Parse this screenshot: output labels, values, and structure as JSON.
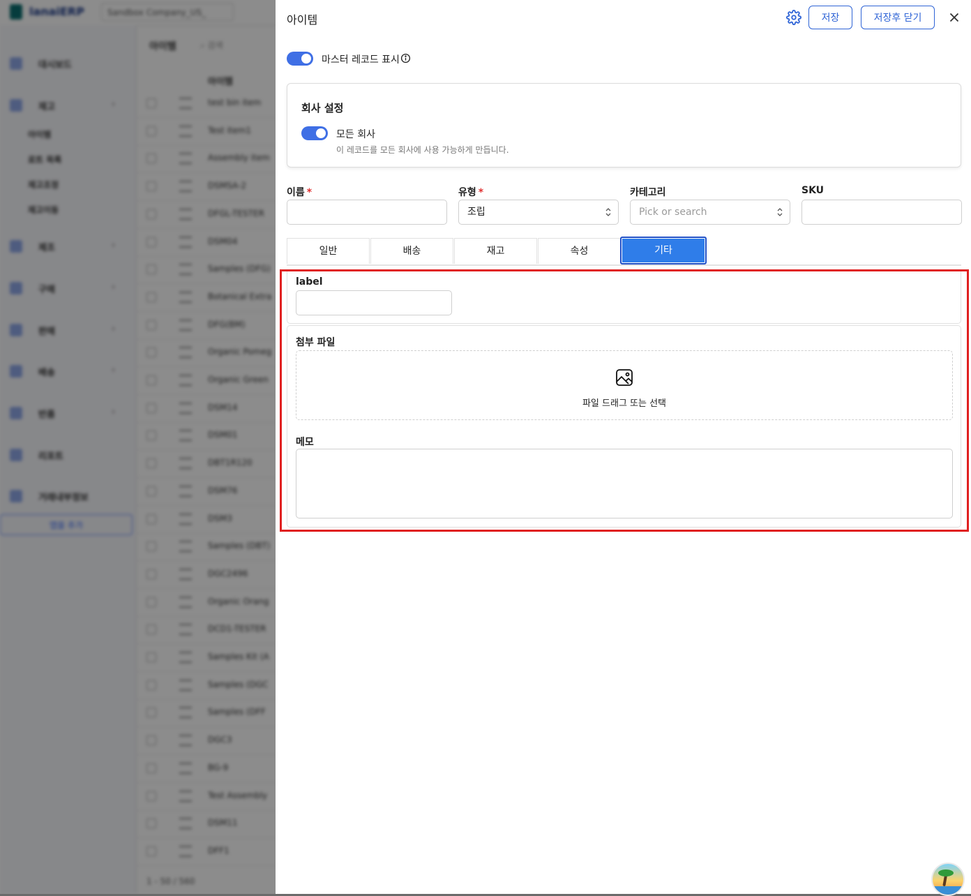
{
  "drawer": {
    "title": "아이템",
    "save_label": "저장",
    "save_close_label": "저장후 닫기",
    "master_toggle_label": "마스터 레코드 표시",
    "master_toggle_on": true
  },
  "company_settings": {
    "title": "회사 설정",
    "all_companies_label": "모든 회사",
    "all_companies_desc": "이 레코드를 모든 회사에 사용 가능하게 만듭니다.",
    "all_companies_on": true
  },
  "fields": {
    "name": {
      "label": "이름",
      "required": "*",
      "value": ""
    },
    "type": {
      "label": "유형",
      "required": "*",
      "value": "조립"
    },
    "category": {
      "label": "카테고리",
      "placeholder": "Pick or search"
    },
    "sku": {
      "label": "SKU",
      "value": ""
    }
  },
  "tabs": [
    {
      "label": "일반",
      "active": false
    },
    {
      "label": "배송",
      "active": false
    },
    {
      "label": "재고",
      "active": false
    },
    {
      "label": "속성",
      "active": false
    },
    {
      "label": "기타",
      "active": true
    }
  ],
  "other_tab": {
    "label_field": "label",
    "attachments_label": "첨부 파일",
    "dropzone_text": "파일 드래그 또는 선택",
    "memo_label": "메모"
  },
  "colors": {
    "accent": "#2f64d6",
    "toggle_on": "#3f6fe5",
    "tab_active": "#2f7de9",
    "highlight": "#e02020",
    "required": "#e03131"
  },
  "background_app": {
    "logo": "lanaiERP",
    "company": "Sandbox Company_US_",
    "nav": [
      {
        "label": "대시보드",
        "expandable": false
      },
      {
        "label": "재고",
        "expandable": true
      },
      {
        "label": "제조",
        "expandable": true
      },
      {
        "label": "구매",
        "expandable": true
      },
      {
        "label": "판매",
        "expandable": true
      },
      {
        "label": "배송",
        "expandable": true
      },
      {
        "label": "반품",
        "expandable": true
      },
      {
        "label": "리포트",
        "expandable": false
      },
      {
        "label": "거래내부정보",
        "expandable": false
      }
    ],
    "subnav": [
      "아이템",
      "로트 목록",
      "재고조정",
      "재고이동"
    ],
    "add_button": "앱을 추가",
    "list_title": "아이템",
    "search_placeholder": "검색",
    "column_header": "아이템",
    "rows": [
      "test bin item",
      "Test item1",
      "Assembly item",
      "DSMSA-2",
      "DFGL-TESTER",
      "DSM04",
      "Samples (DFG)",
      "Botanical Extra",
      "DFG(BM)",
      "Organic Pomeg",
      "Organic Green",
      "DSM14",
      "DSM01",
      "DBT1R120",
      "DSM76",
      "DSM3",
      "Samples (DBT)",
      "DGC2496",
      "Organic Orang",
      "DCD1-TESTER",
      "Samples Kit (A",
      "Samples (DGC",
      "Samples (DFF",
      "DGC3",
      "BG-9",
      "Test Assembly",
      "DSM11",
      "DFF1"
    ],
    "pager": "1 - 50 / 560"
  }
}
